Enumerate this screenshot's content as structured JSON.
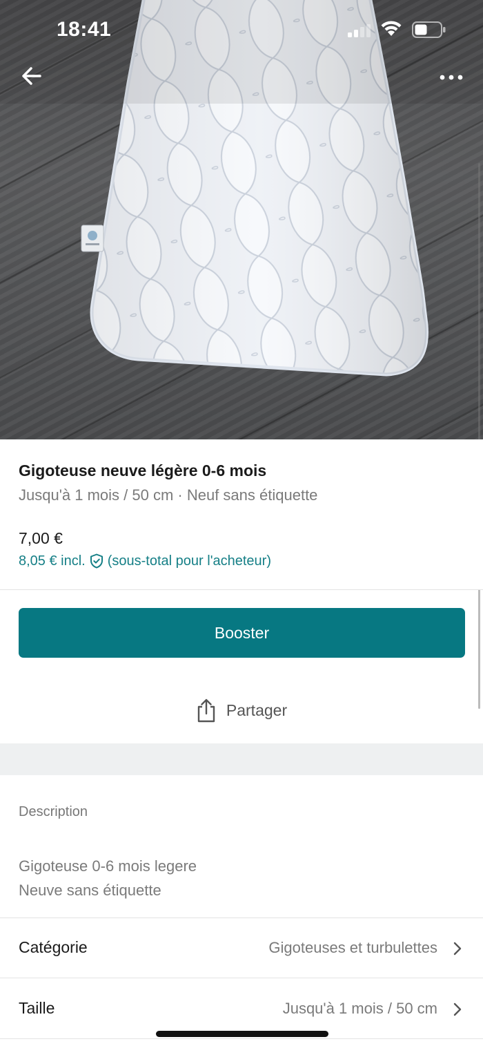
{
  "status_bar": {
    "time": "18:41"
  },
  "listing": {
    "title": "Gigoteuse neuve légère 0-6 mois",
    "subtitle": "Jusqu'à 1 mois / 50 cm · Neuf sans étiquette",
    "price": "7,00 €",
    "price_incl": "8,05 € incl.",
    "price_incl_note": "(sous-total pour l'acheteur)"
  },
  "actions": {
    "boost_label": "Booster",
    "share_label": "Partager"
  },
  "description": {
    "heading": "Description",
    "line1": "Gigoteuse 0-6 mois legere",
    "line2": "Neuve sans étiquette"
  },
  "details": [
    {
      "label": "Catégorie",
      "value": "Gigoteuses et turbulettes"
    },
    {
      "label": "Taille",
      "value": "Jusqu'à 1 mois / 50 cm"
    }
  ],
  "icons": {
    "back": "arrow-left-icon",
    "more": "more-dots-icon",
    "share": "share-icon",
    "protection": "shield-check-icon",
    "chevron": "chevron-right-icon"
  },
  "colors": {
    "accent": "#077882",
    "accent_text": "#157f86"
  }
}
